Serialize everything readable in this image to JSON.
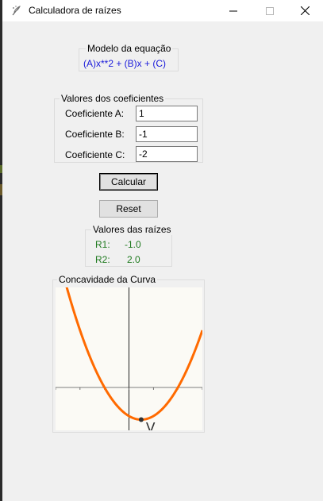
{
  "window": {
    "title": "Calculadora de raízes",
    "icon": "feather-icon",
    "controls": [
      "minimize-icon",
      "maximize-icon",
      "close-icon"
    ]
  },
  "model": {
    "legend": "Modelo da equação",
    "equation": "(A)x**2 + (B)x + (C)"
  },
  "coefficients": {
    "legend": "Valores dos coeficientes",
    "a_label": "Coeficiente A:",
    "a_value": "1",
    "b_label": "Coeficiente B:",
    "b_value": "-1",
    "c_label": "Coeficiente C:",
    "c_value": "-2"
  },
  "buttons": {
    "calculate": "Calcular",
    "reset": "Reset"
  },
  "roots": {
    "legend": "Valores das raízes",
    "r1_label": "R1:",
    "r1_value": "-1.0",
    "r2_label": "R2:",
    "r2_value": "2.0"
  },
  "curve": {
    "legend": "Concavidade da Curva",
    "vertex_label": "V",
    "line_color": "#ff6a00",
    "vertex_color": "#333333"
  },
  "chart_data": {
    "type": "line",
    "function": "y = x^2 - x - 2",
    "a": 1,
    "b": -1,
    "c": -2,
    "xlim": [
      -3,
      3
    ],
    "ylim": [
      -3,
      7
    ],
    "vertex": [
      0.5,
      -2.25
    ],
    "title": "",
    "xlabel": "",
    "ylabel": "",
    "grid": false
  }
}
